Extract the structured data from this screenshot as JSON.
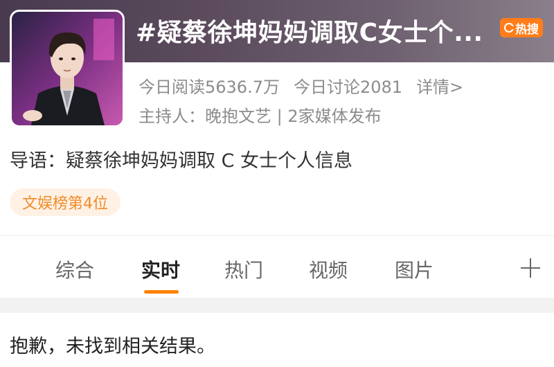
{
  "topic": {
    "title": "#疑蔡徐坤妈妈调取C女士个...",
    "hot_badge": "热搜"
  },
  "stats": {
    "reads": "今日阅读5636.7万",
    "discussions": "今日讨论2081",
    "details": "详情>"
  },
  "host": "主持人：晚抱文艺 | 2家媒体发布",
  "intro": "导语：疑蔡徐坤妈妈调取 C 女士个人信息",
  "rank_tag": "文娱榜第4位",
  "tabs": [
    {
      "label": "综合",
      "active": false
    },
    {
      "label": "实时",
      "active": true
    },
    {
      "label": "热门",
      "active": false
    },
    {
      "label": "视频",
      "active": false
    },
    {
      "label": "图片",
      "active": false
    }
  ],
  "results": {
    "empty_message": "抱歉，未找到相关结果。"
  },
  "colors": {
    "accent": "#ff8200",
    "badge": "#ff7d1a",
    "rank_tag_bg": "#fff1e4",
    "rank_tag_text": "#f08c2a"
  },
  "icons": {
    "add": "plus-icon",
    "hot": "hot-search-icon"
  }
}
